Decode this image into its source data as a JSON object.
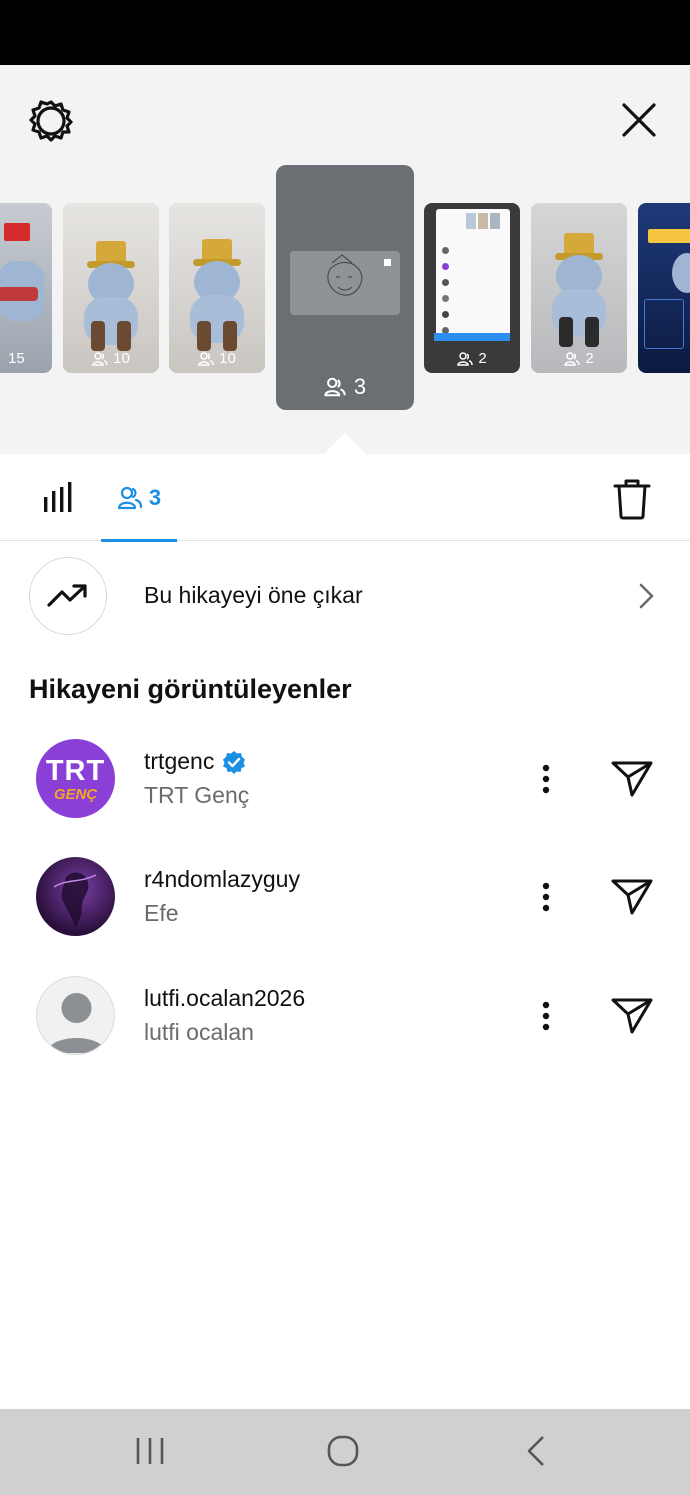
{
  "header": {
    "settings_icon": "gear-icon",
    "close_icon": "close-icon"
  },
  "stories": [
    {
      "viewers": "15",
      "selected": false
    },
    {
      "viewers": "10",
      "selected": false
    },
    {
      "viewers": "10",
      "selected": false
    },
    {
      "viewers": "3",
      "selected": true
    },
    {
      "viewers": "2",
      "selected": false
    },
    {
      "viewers": "2",
      "selected": false
    },
    {
      "viewers": "",
      "selected": false
    }
  ],
  "tabs": {
    "insights_icon": "bar-chart-icon",
    "viewers_count": "3",
    "delete_icon": "trash-icon"
  },
  "promote": {
    "label": "Bu hikayeyi öne çıkar"
  },
  "viewers_section": {
    "title": "Hikayeni görüntüleyenler",
    "items": [
      {
        "username": "trtgenc",
        "full_name": "TRT Genç",
        "verified": true
      },
      {
        "username": "r4ndomlazyguy",
        "full_name": "Efe",
        "verified": false
      },
      {
        "username": "lutfi.ocalan2026",
        "full_name": "lutfi ocalan",
        "verified": false
      }
    ]
  },
  "avatar_text": {
    "trt_top": "TRT",
    "trt_bottom": "GENÇ"
  },
  "colors": {
    "accent": "#1a8fe3",
    "trt_purple": "#8a3fd6",
    "trt_orange": "#f5a623"
  }
}
